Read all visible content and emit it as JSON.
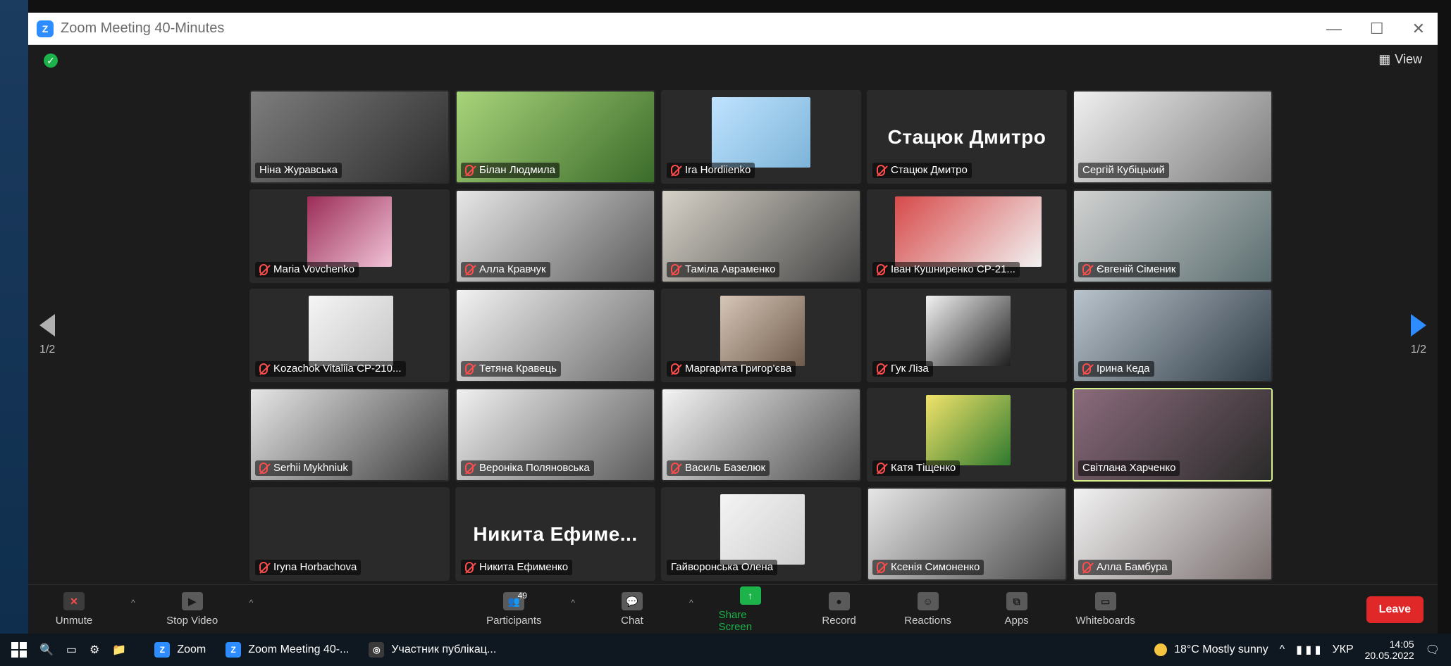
{
  "window": {
    "title": "Zoom Meeting 40-Minutes",
    "controls": {
      "minimize": "—",
      "maximize": "☐",
      "close": "✕"
    }
  },
  "meeting": {
    "view_label": "View",
    "pagination": {
      "left": "1/2",
      "right": "1/2"
    }
  },
  "tiles": [
    {
      "name": "Ніна Журавська",
      "muted": false,
      "display": ""
    },
    {
      "name": "Білан Людмила",
      "muted": true,
      "display": ""
    },
    {
      "name": "Ira Hordiienko",
      "muted": true,
      "display": ""
    },
    {
      "name": "Стацюк Дмитро",
      "muted": true,
      "display": "Стацюк Дмитро"
    },
    {
      "name": "Сергій Кубіцький",
      "muted": false,
      "display": ""
    },
    {
      "name": "Maria Vovchenko",
      "muted": true,
      "display": ""
    },
    {
      "name": "Алла Кравчук",
      "muted": true,
      "display": ""
    },
    {
      "name": "Таміла Авраменко",
      "muted": true,
      "display": ""
    },
    {
      "name": "Іван Кушниренко СР-21...",
      "muted": true,
      "display": ""
    },
    {
      "name": "Євгеній Сіменик",
      "muted": true,
      "display": ""
    },
    {
      "name": "Kozachok Vitaliia СР-210...",
      "muted": true,
      "display": ""
    },
    {
      "name": "Тетяна Кравець",
      "muted": true,
      "display": ""
    },
    {
      "name": "Маргарита Григор'єва",
      "muted": true,
      "display": ""
    },
    {
      "name": "Гук Ліза",
      "muted": true,
      "display": ""
    },
    {
      "name": "Ірина Кеда",
      "muted": true,
      "display": ""
    },
    {
      "name": "Serhii Mykhniuk",
      "muted": true,
      "display": ""
    },
    {
      "name": "Вероніка Поляновська",
      "muted": true,
      "display": ""
    },
    {
      "name": "Василь Базелюк",
      "muted": true,
      "display": ""
    },
    {
      "name": "Катя Тіщенко",
      "muted": true,
      "display": ""
    },
    {
      "name": "Світлана Харченко",
      "muted": false,
      "display": "",
      "active": true
    },
    {
      "name": "Iryna Horbachova",
      "muted": true,
      "display": ""
    },
    {
      "name": "Никита Ефименко",
      "muted": true,
      "display": "Никита Ефиме..."
    },
    {
      "name": "Гайворонська Олена",
      "muted": false,
      "display": ""
    },
    {
      "name": "Ксенія Симоненко",
      "muted": true,
      "display": ""
    },
    {
      "name": "Алла Бамбура",
      "muted": true,
      "display": ""
    }
  ],
  "toolbar": {
    "unmute": "Unmute",
    "stop_video": "Stop Video",
    "participants": "Participants",
    "participants_count": "49",
    "chat": "Chat",
    "share_screen": "Share Screen",
    "record": "Record",
    "reactions": "Reactions",
    "apps": "Apps",
    "whiteboards": "Whiteboards",
    "leave": "Leave",
    "caret": "^"
  },
  "taskbar": {
    "zoom_label": "Zoom",
    "meeting_label": "Zoom Meeting 40-...",
    "chrome_label": "Участник публікац...",
    "weather": "18°C  Mostly sunny",
    "lang": "УКР",
    "time": "14:05",
    "date": "20.05.2022"
  },
  "colors": {
    "accent_blue": "#2d8cff",
    "green": "#1bb34a",
    "leave_red": "#e02828",
    "active_border": "#d6f08b"
  },
  "icons": {
    "shield": "shield-check-icon",
    "grid_view": "grid-icon",
    "mic": "mic-muted-icon",
    "video": "video-icon",
    "participants": "people-icon",
    "chat": "chat-icon",
    "share": "share-screen-icon",
    "record": "record-icon",
    "reactions": "reactions-icon",
    "apps": "apps-icon",
    "whiteboard": "whiteboard-icon",
    "windows": "windows-icon"
  }
}
